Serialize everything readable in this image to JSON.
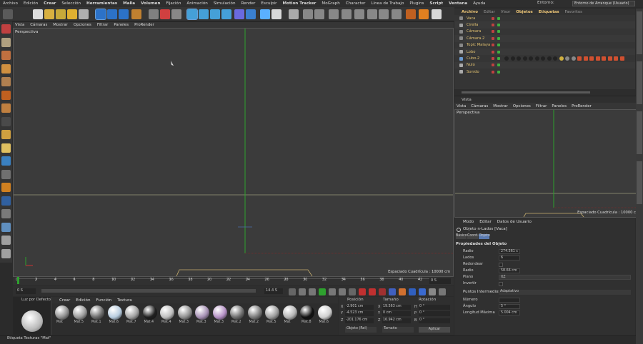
{
  "menubar": {
    "items": [
      "Archivo",
      "Edición",
      "Crear",
      "Selección",
      "Herramientas",
      "Malla",
      "Volumen",
      "Fijación",
      "Animación",
      "Simulación",
      "Render",
      "Esculpir",
      "Motion Tracker",
      "MoGraph",
      "Character",
      "Línea de Trabajo",
      "Plugins",
      "Script",
      "Ventana",
      "Ayuda"
    ],
    "env_label": "Entorno:",
    "env_value": "Entorno de Arranque (Usuario)"
  },
  "viewport": {
    "menu": [
      "Vista",
      "Cámaras",
      "Mostrar",
      "Opciones",
      "Filtrar",
      "Paneles",
      "ProRender"
    ],
    "label": "Perspectiva",
    "grid_spacing": "Espaciado Cuadrícula : 10000 cm"
  },
  "timeline": {
    "ticks": [
      "0",
      "2",
      "4",
      "6",
      "8",
      "10",
      "12",
      "14",
      "16",
      "18",
      "20",
      "22",
      "24",
      "26",
      "28",
      "30",
      "32",
      "34",
      "36",
      "38",
      "40",
      "42"
    ],
    "end_field": "0 S"
  },
  "transport": {
    "start": "0 S",
    "current": "0 S",
    "end": "14.4 S",
    "end2": "14.4 S"
  },
  "materials": {
    "menu": [
      "Crear",
      "Edición",
      "Función",
      "Textura"
    ],
    "preview_label": "Luz por Defecto",
    "items": [
      {
        "label": "Mat",
        "color": "#8f8f8f"
      },
      {
        "label": "Mat.5",
        "color": "#9a9a9a"
      },
      {
        "label": "Mat.1",
        "color": "#6c6c6c"
      },
      {
        "label": "Mat.6",
        "color": "#b8cde0"
      },
      {
        "label": "Mat.7",
        "color": "#a0a0a0"
      },
      {
        "label": "Mat.4",
        "color": "#202020"
      },
      {
        "label": "Mat.4",
        "color": "#bfbfbf"
      },
      {
        "label": "Mat.3",
        "color": "#909090"
      },
      {
        "label": "Mat.3",
        "color": "#a58fb3"
      },
      {
        "label": "Mat.3",
        "color": "#b38fc4"
      },
      {
        "label": "Mat.2",
        "color": "#6e6e6e"
      },
      {
        "label": "Mat.2",
        "color": "#7a7a7a"
      },
      {
        "label": "Mat.5",
        "color": "#9c9c9c"
      },
      {
        "label": "Mat",
        "color": "#b5b5b5"
      },
      {
        "label": "Mat.8",
        "color": "#111111"
      },
      {
        "label": "Mat.6",
        "color": "#d0d0d0"
      }
    ]
  },
  "coords": {
    "headers": [
      "Posición",
      "Tamaño",
      "Rotación"
    ],
    "rows": [
      {
        "axis": "X",
        "pos": "-2.901 cm",
        "size_axis": "X",
        "size": "19.563 cm",
        "rot_axis": "H",
        "rot": "0 °"
      },
      {
        "axis": "Y",
        "pos": "-4.523 cm",
        "size_axis": "Y",
        "size": "0 cm",
        "rot_axis": "P",
        "rot": "0 °"
      },
      {
        "axis": "Z",
        "pos": "-201.176 cm",
        "size_axis": "Z",
        "size": "16.942 cm",
        "rot_axis": "B",
        "rot": "0 °"
      }
    ],
    "mode1": "Objeto (Rel)",
    "mode2": "Tamaño",
    "apply": "Aplicar"
  },
  "objects": {
    "tabs": [
      "Archivo",
      "Editar",
      "Visor",
      "Objetos",
      "Etiquetas",
      "Favoritos"
    ],
    "items": [
      "Vaca",
      "Cirella",
      "Cámara",
      "Cámara.2",
      "Topic Malaya",
      "Lobo",
      "Cubo.2",
      "Nulo",
      "Sonido"
    ]
  },
  "viewport2": {
    "title": "Vista",
    "menu": [
      "Vista",
      "Cámaras",
      "Mostrar",
      "Opciones",
      "Filtrar",
      "Paneles",
      "ProRender"
    ],
    "label": "Perspectiva",
    "grid_spacing": "Espaciado Cuadrícula : 10000 cm"
  },
  "attributes": {
    "menu": [
      "Modo",
      "Editar",
      "Datos de Usuario"
    ],
    "object_title": "Objeto n-Lados [Vaca]",
    "tabs": [
      "Básico",
      "Coord.",
      "Objeto"
    ],
    "section1": "Propiedades del Objeto",
    "props": [
      {
        "label": "Radio",
        "value": "274.561 c"
      },
      {
        "label": "Lados",
        "value": "6"
      },
      {
        "label": "Redondear",
        "value": ""
      },
      {
        "label": "Radio",
        "value": "58.66 cm"
      },
      {
        "label": "Plano",
        "value": "XZ"
      },
      {
        "label": "Invertir",
        "value": ""
      }
    ],
    "section2": "Puntos Intermedios",
    "section2_value": "Adaptativo",
    "props2": [
      {
        "label": "Número",
        "value": ""
      },
      {
        "label": "Ángulo",
        "value": "5 °"
      },
      {
        "label": "Longitud Máxima",
        "value": "5.004 cm"
      }
    ]
  },
  "status": {
    "text": "Etiqueta Texturas \"Mat\""
  }
}
